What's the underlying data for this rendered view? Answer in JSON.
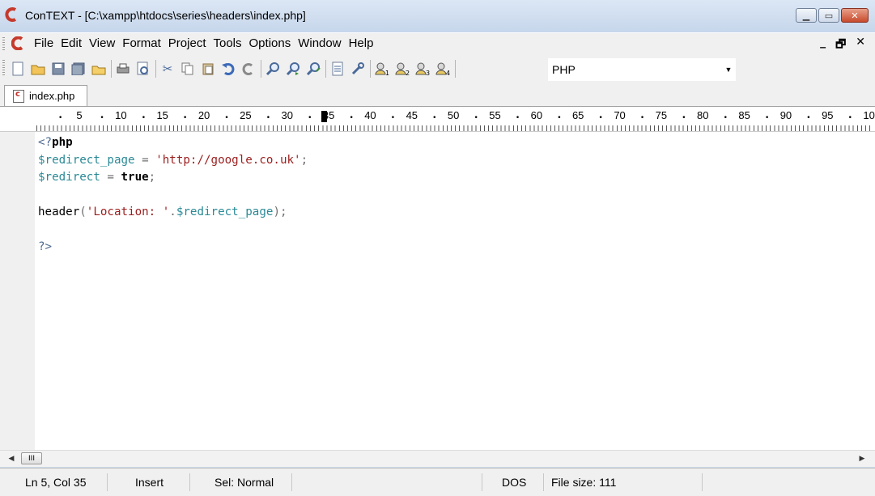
{
  "window": {
    "title": "ConTEXT - [C:\\xampp\\htdocs\\series\\headers\\index.php]",
    "controls": {
      "minimize": "▁",
      "maximize": "▭",
      "close": "✕"
    }
  },
  "menu": {
    "items": [
      "File",
      "Edit",
      "View",
      "Format",
      "Project",
      "Tools",
      "Options",
      "Window",
      "Help"
    ],
    "mdi_controls": {
      "minimize": "_",
      "restore": "🗗",
      "close": "✕"
    }
  },
  "toolbar": {
    "language_select": {
      "value": "PHP",
      "arrow": "▼"
    }
  },
  "tabs": [
    {
      "label": "index.php"
    }
  ],
  "ruler": {
    "labels": [
      "5",
      "10",
      "15",
      "20",
      "25",
      "30",
      "35",
      "40",
      "45",
      "50",
      "55",
      "60",
      "65",
      "70",
      "75",
      "80",
      "85",
      "90",
      "95",
      "10"
    ]
  },
  "editor": {
    "lines": [
      [
        {
          "t": "<?",
          "c": "tag"
        },
        {
          "t": "php",
          "c": "kw"
        }
      ],
      [
        {
          "t": "$redirect_page",
          "c": "var"
        },
        {
          "t": " = ",
          "c": "op"
        },
        {
          "t": "'http://google.co.uk'",
          "c": "str"
        },
        {
          "t": ";",
          "c": "op"
        }
      ],
      [
        {
          "t": "$redirect",
          "c": "var"
        },
        {
          "t": " = ",
          "c": "op"
        },
        {
          "t": "true",
          "c": "kw"
        },
        {
          "t": ";",
          "c": "op"
        }
      ],
      [
        {
          "t": "",
          "c": "op"
        }
      ],
      [
        {
          "t": "header",
          "c": "fn"
        },
        {
          "t": "(",
          "c": "op"
        },
        {
          "t": "'Location: '",
          "c": "str"
        },
        {
          "t": ".",
          "c": "op"
        },
        {
          "t": "$redirect_page",
          "c": "var"
        },
        {
          "t": ");",
          "c": "op"
        }
      ],
      [
        {
          "t": "",
          "c": "op"
        }
      ],
      [
        {
          "t": "?>",
          "c": "tag"
        }
      ]
    ]
  },
  "scrollbar": {
    "left_arrow": "◀",
    "right_arrow": "▶",
    "thumb": "III"
  },
  "status": {
    "position": "Ln 5, Col 35",
    "mode": "Insert",
    "selection": "Sel: Normal",
    "line_ending": "DOS",
    "file_size": "File size: 111"
  },
  "colors": {
    "titlebar": "#c6d6eb",
    "close_button": "#c84a2c",
    "string": "#9b1e1e",
    "variable": "#2a8a96"
  }
}
